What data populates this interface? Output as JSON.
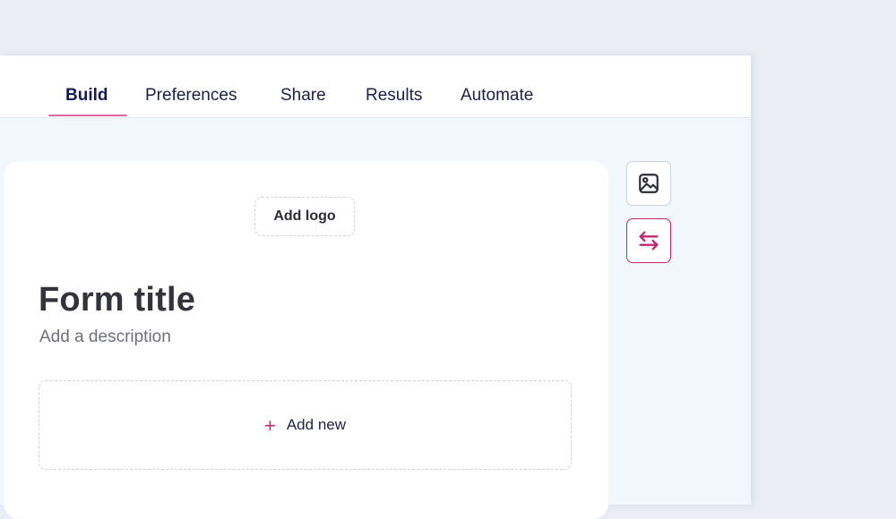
{
  "tabs": [
    {
      "label": "Build",
      "active": true
    },
    {
      "label": "Preferences",
      "active": false
    },
    {
      "label": "Share",
      "active": false
    },
    {
      "label": "Results",
      "active": false
    },
    {
      "label": "Automate",
      "active": false
    }
  ],
  "form": {
    "add_logo_label": "Add logo",
    "title": "Form title",
    "description_placeholder": "Add a description",
    "add_new_label": "Add new",
    "add_new_icon": "plus-icon"
  },
  "side_tools": [
    {
      "name": "image-icon",
      "active": false
    },
    {
      "name": "swap-arrows-icon",
      "active": true
    }
  ],
  "colors": {
    "accent": "#c2266f",
    "tab_underline": "#e0669e",
    "text_primary": "#161a52",
    "background": "#eaedf6",
    "canvas": "#f2f6fd"
  }
}
